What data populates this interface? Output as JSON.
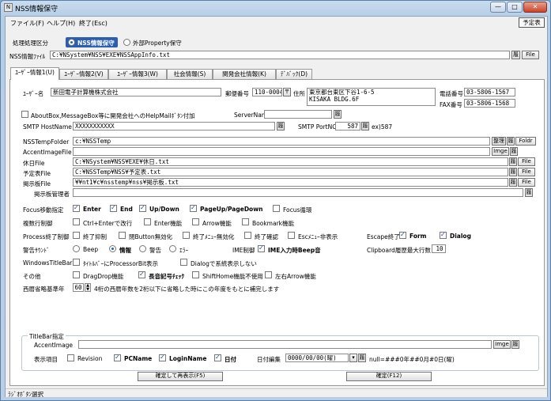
{
  "window": {
    "title": "NSS情報保守",
    "app_icon": "app-icon",
    "close_glyph": "✕",
    "min_glyph": "—",
    "max_glyph": "□"
  },
  "menu": {
    "file": "ファイル(F)",
    "help": "ヘルプ(H)",
    "exit": "終了(Esc)",
    "schedule_button": "予定表"
  },
  "mode": {
    "label": "処理処理区分",
    "option1": "NSS情報保守",
    "option2": "外部Property保守",
    "selected": "NSS情報保守"
  },
  "ini": {
    "label": "NSS情報ﾌｧｲﾙ",
    "value": "C:¥NSystem¥NSS¥EXE¥NSSAppInfo.txt",
    "browse": "履",
    "file_btn": "File"
  },
  "tabs": [
    "ﾕｰｻﾞｰ情報1(U)",
    "ﾕｰｻﾞｰ情報2(V)",
    "ﾕｰｻﾞｰ情報3(W)",
    "社会情報(S)",
    "関発会社情報(K)",
    "ﾃﾞﾊﾞｯｸ(D)"
  ],
  "user": {
    "name_label": "ﾕｰｻﾞｰ名",
    "name_value": "新田電子計算機株式会社",
    "zip_label": "郵便番号",
    "zip_value": "110-0004",
    "zip_btn": "〒",
    "addr_label": "住所",
    "addr_line1": "東京都台東区下谷1-6-5",
    "addr_line2": "KISAKA BLDG.6F",
    "tel_label": "電話番号",
    "tel_value": "03-5806-1567",
    "fax_label": "FAX番号",
    "fax_value": "03-5806-1568"
  },
  "about": {
    "label": "AboutBox,MessageBox等に開発会社へのHelpMailﾎﾞﾀﾝ付加",
    "server_label": "ServerName",
    "server_value": ""
  },
  "smtp": {
    "host_label": "SMTP HostName",
    "host_value": "XXXXXXXXXXX",
    "port_label": "SMTP PortNO",
    "port_value": "587",
    "port_hint": "ex)587"
  },
  "paths": {
    "temp_label": "NSSTempFolder",
    "temp_value": "c:¥NSSTemp",
    "tidy": "整理",
    "foldr": "Foldr",
    "accent_label": "AccentImageFile",
    "accent_value": "",
    "image": "Imge",
    "holiday_label": "休日File",
    "holiday_value": "C:¥NSystem¥NSS¥EXE¥休日.txt",
    "schedule_label": "予定表File",
    "schedule_value": "C:¥NSSTemp¥NSS¥予定表.txt",
    "board_label": "掲示板File",
    "board_value": "¥¥nt1¥c¥nsstemp¥nss¥掲示板.txt",
    "admin_label": "掲示板管理者",
    "admin_value": "",
    "file": "File",
    "browse": "履"
  },
  "focus": {
    "label": "Focus移動指定",
    "items": [
      {
        "t": "Enter",
        "on": true
      },
      {
        "t": "End",
        "on": true
      },
      {
        "t": "Up/Down",
        "on": true
      },
      {
        "t": "PageUp/PageDown",
        "on": true
      },
      {
        "t": "Focus循環",
        "on": false
      }
    ]
  },
  "multi": {
    "label": "複数行制御",
    "items": [
      {
        "t": "Ctrl+Enterで改行",
        "on": false
      },
      {
        "t": "Enter機能",
        "on": false
      },
      {
        "t": "Arrow機能",
        "on": false
      },
      {
        "t": "Bookmark機能",
        "on": false
      }
    ]
  },
  "proc": {
    "label": "Process終了制御",
    "items": [
      {
        "t": "終了抑制",
        "on": false
      },
      {
        "t": "閉Button無効化",
        "on": false
      },
      {
        "t": "終了ﾒﾆｭｰ無効化",
        "on": false
      },
      {
        "t": "終了確認",
        "on": false
      },
      {
        "t": "Escﾒﾆｭｰ非表示",
        "on": false
      }
    ],
    "esc_label": "Escape終了",
    "form": "Form",
    "dialog": "Dialog"
  },
  "warn": {
    "label": "警告ｻｳﾝﾄﾞ",
    "beep": "Beep",
    "info": "情報",
    "warn": "警告",
    "error": "ｴﾗｰ",
    "selected": "情報",
    "ime_label": "IME制御",
    "ime_value": "IME入力時Beep音",
    "clip_label": "Clipboard履歴最大行数",
    "clip_value": "10"
  },
  "wtb": {
    "label": "WindowsTitleBar",
    "items": [
      {
        "t": "ﾀｲﾄﾙﾊﾞｰにProcessorBit表示",
        "on": false
      },
      {
        "t": "Dialogで系統表示しない",
        "on": false
      }
    ]
  },
  "other": {
    "label": "その他",
    "items": [
      {
        "t": "DragDrop機能",
        "on": false
      },
      {
        "t": "長音記号ﾁｪｯｸ",
        "on": true
      },
      {
        "t": "ShiftHome機能不使用",
        "on": false
      },
      {
        "t": "左右Arrow機能",
        "on": false
      }
    ]
  },
  "era": {
    "label": "西暦省略基準年",
    "value": "60",
    "desc": "4桁の西暦年数を2桁以下に省略した時にこの年度をもとに補完します"
  },
  "titlebar": {
    "group": "TitleBar指定",
    "accent_label": "AccentImage",
    "accent_value": "",
    "image": "Imge",
    "browse": "履",
    "show_label": "表示項目",
    "items": [
      {
        "t": "Revision",
        "on": false
      },
      {
        "t": "PCName",
        "on": true
      },
      {
        "t": "LoginName",
        "on": true
      },
      {
        "t": "日付",
        "on": true
      }
    ],
    "date_label": "日付編集",
    "date_value": "0000/00/00(曜)",
    "null_text": "null=###0年##0月#0日(曜)"
  },
  "buttons": {
    "confirm_redisplay": "確定して再表示(F5)",
    "confirm": "確定(F12)"
  },
  "status": {
    "text": "ﾗｼﾞｵﾎﾞﾀﾝ選択"
  },
  "colors": {
    "accent": "#2a5fb0",
    "titlebar": "#c9dcef"
  }
}
